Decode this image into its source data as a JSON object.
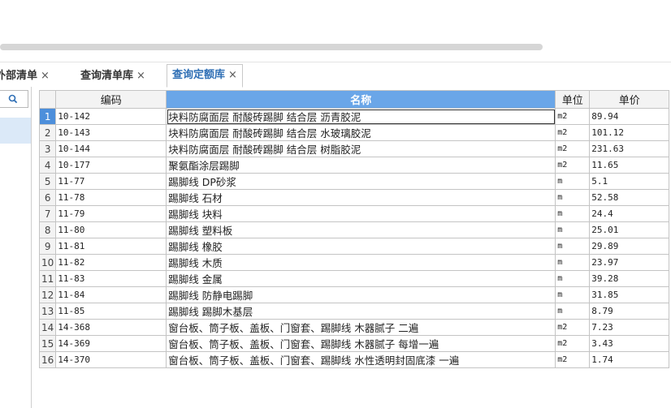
{
  "tabs": [
    {
      "label": "外部清单",
      "close": "×"
    },
    {
      "label": "查询清单库",
      "close": "×"
    },
    {
      "label": "查询定额库",
      "close": "×"
    }
  ],
  "columns": {
    "code": "编码",
    "name": "名称",
    "unit": "单位",
    "price": "单价"
  },
  "rows": [
    {
      "n": "1",
      "code": "10-142",
      "name": "块料防腐面层 耐酸砖踢脚 结合层 沥青胶泥",
      "unit": "m2",
      "price": "89.94"
    },
    {
      "n": "2",
      "code": "10-143",
      "name": "块料防腐面层 耐酸砖踢脚 结合层 水玻璃胶泥",
      "unit": "m2",
      "price": "101.12"
    },
    {
      "n": "3",
      "code": "10-144",
      "name": "块料防腐面层 耐酸砖踢脚 结合层 树脂胶泥",
      "unit": "m2",
      "price": "231.63"
    },
    {
      "n": "4",
      "code": "10-177",
      "name": "聚氨酯涂层踢脚",
      "unit": "m2",
      "price": "11.65"
    },
    {
      "n": "5",
      "code": "11-77",
      "name": "踢脚线 DP砂浆",
      "unit": "m",
      "price": "5.1"
    },
    {
      "n": "6",
      "code": "11-78",
      "name": "踢脚线 石材",
      "unit": "m",
      "price": "52.58"
    },
    {
      "n": "7",
      "code": "11-79",
      "name": "踢脚线 块料",
      "unit": "m",
      "price": "24.4"
    },
    {
      "n": "8",
      "code": "11-80",
      "name": "踢脚线 塑料板",
      "unit": "m",
      "price": "25.01"
    },
    {
      "n": "9",
      "code": "11-81",
      "name": "踢脚线 橡胶",
      "unit": "m",
      "price": "29.89"
    },
    {
      "n": "10",
      "code": "11-82",
      "name": "踢脚线 木质",
      "unit": "m",
      "price": "23.97"
    },
    {
      "n": "11",
      "code": "11-83",
      "name": "踢脚线 金属",
      "unit": "m",
      "price": "39.28"
    },
    {
      "n": "12",
      "code": "11-84",
      "name": "踢脚线 防静电踢脚",
      "unit": "m",
      "price": "31.85"
    },
    {
      "n": "13",
      "code": "11-85",
      "name": "踢脚线 踢脚木基层",
      "unit": "m",
      "price": "8.79"
    },
    {
      "n": "14",
      "code": "14-368",
      "name": "窗台板、筒子板、盖板、门窗套、踢脚线 木器腻子 二遍",
      "unit": "m2",
      "price": "7.23"
    },
    {
      "n": "15",
      "code": "14-369",
      "name": "窗台板、筒子板、盖板、门窗套、踢脚线 木器腻子 每增一遍",
      "unit": "m2",
      "price": "3.43"
    },
    {
      "n": "16",
      "code": "14-370",
      "name": "窗台板、筒子板、盖板、门窗套、踢脚线 水性透明封固底漆 一遍",
      "unit": "m2",
      "price": "1.74"
    }
  ],
  "colors": {
    "accent": "#2f6fb5",
    "header_highlight": "#6aa6e8",
    "selected_row_number": "#4d8fdb"
  }
}
